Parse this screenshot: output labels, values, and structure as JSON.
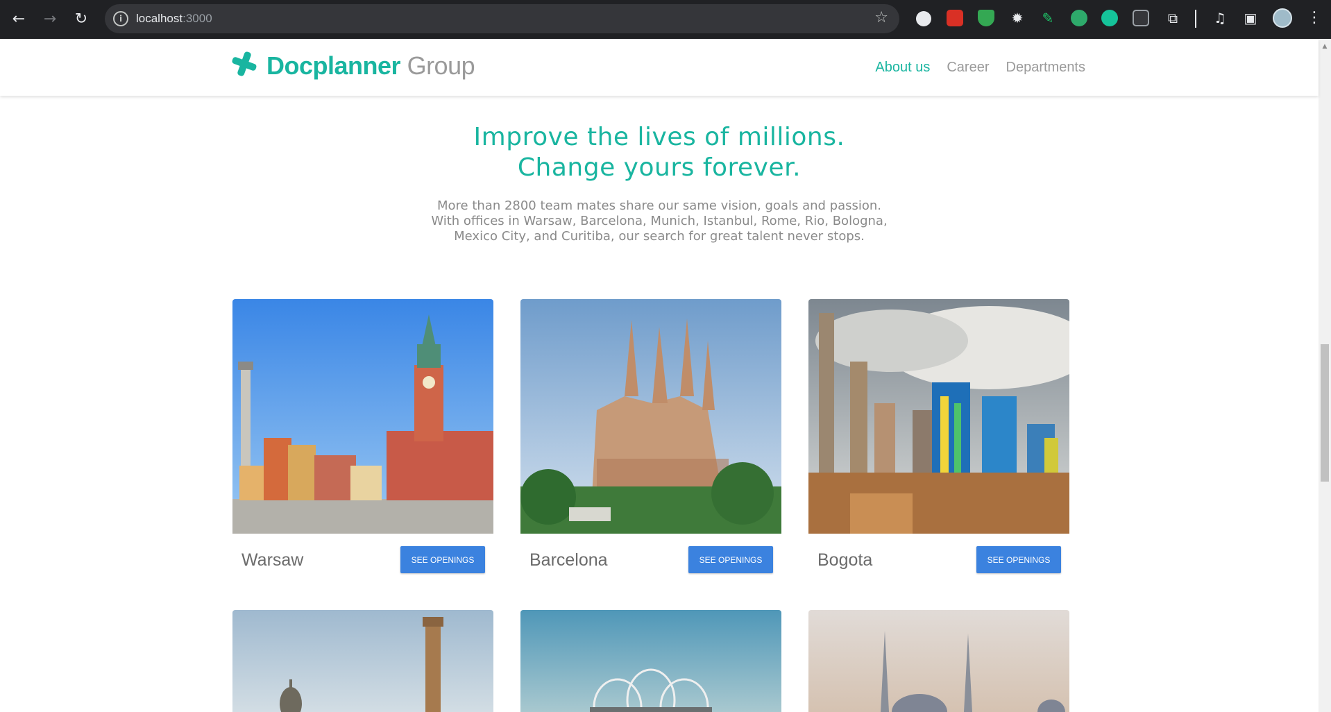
{
  "browser": {
    "url_host": "localhost",
    "url_port": ":3000",
    "back_icon": "arrow-back-icon",
    "forward_icon": "arrow-forward-icon",
    "reload_icon": "reload-icon",
    "extensions": [
      "ext-tab-icon",
      "ext-red-icon",
      "ext-shield-icon",
      "ext-gear-icon",
      "ext-pen-icon",
      "ext-robot-icon",
      "ext-grammarly-icon",
      "ext-page-icon",
      "ext-puzzle-icon"
    ]
  },
  "header": {
    "logo_brand": "Docplanner",
    "logo_group": "Group",
    "nav": [
      {
        "label": "About us",
        "active": true
      },
      {
        "label": "Career",
        "active": false
      },
      {
        "label": "Departments",
        "active": false
      }
    ]
  },
  "hero": {
    "title_line1": "Improve the lives of millions.",
    "title_line2": "Change yours forever.",
    "text_line1": "More than 2800 team mates share our same vision, goals and passion.",
    "text_line2": "With offices in Warsaw, Barcelona, Munich, Istanbul, Rome, Rio, Bologna,",
    "text_line3": "Mexico City, and Curitiba, our search for great talent never stops."
  },
  "offices": [
    {
      "city": "Warsaw",
      "button": "SEE OPENINGS"
    },
    {
      "city": "Barcelona",
      "button": "SEE OPENINGS"
    },
    {
      "city": "Bogota",
      "button": "SEE OPENINGS"
    }
  ],
  "colors": {
    "accent": "#19b5a0",
    "button": "#3b82df",
    "muted_text": "#8a8a8a"
  }
}
